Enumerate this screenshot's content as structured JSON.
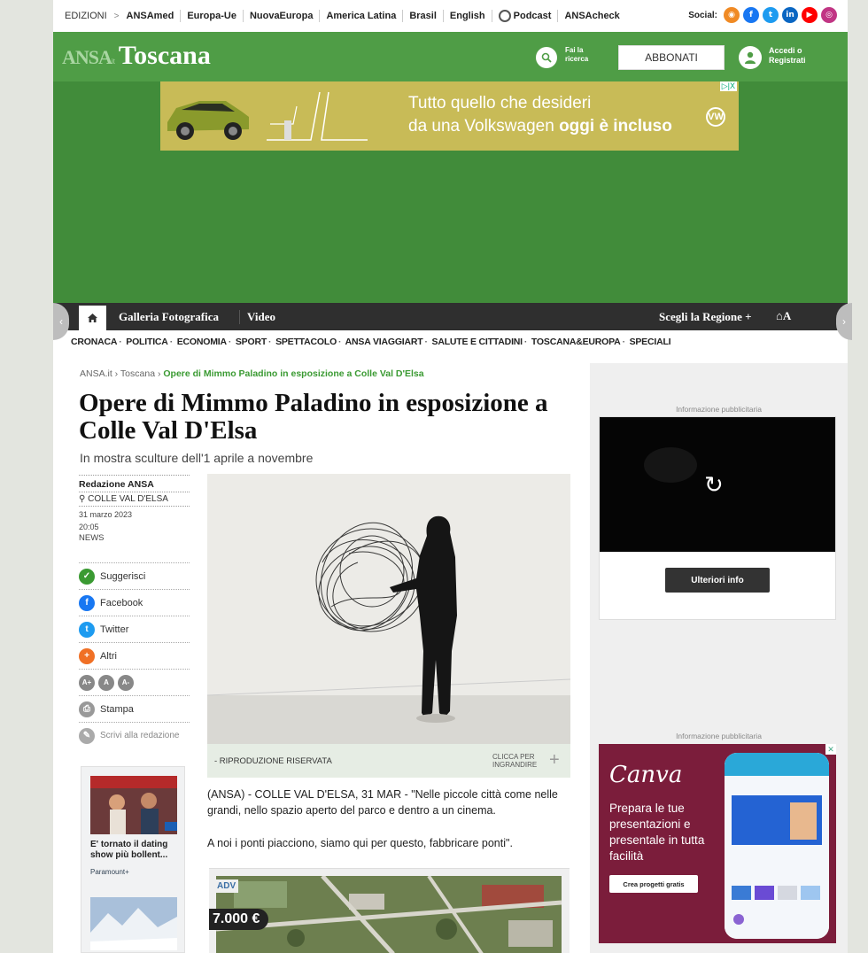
{
  "topbar": {
    "edition_label": "EDIZIONI",
    "links": [
      "ANSAmed",
      "Europa-Ue",
      "NuovaEuropa",
      "America Latina",
      "Brasil",
      "English",
      "Podcast",
      "ANSAcheck"
    ],
    "social_label": "Social:"
  },
  "header": {
    "logo_ansa": "ANSA",
    "logo_it": "it",
    "region": "Toscana",
    "search_label_1": "Fai la",
    "search_label_2": "ricerca",
    "subscribe": "ABBONATI",
    "login_1": "Accedi o",
    "login_2": "Registrati"
  },
  "banner": {
    "line1": "Tutto quello che desideri",
    "line2_plain": "da una Volkswagen ",
    "line2_bold": "oggi è incluso",
    "vw": "VW",
    "adchoice": "▷|X"
  },
  "nav": {
    "gallery": "Galleria Fotografica",
    "video": "Video",
    "region_pick": "Scegli la Regione +",
    "text_size": "A"
  },
  "subnav": [
    "CRONACA",
    "POLITICA",
    "ECONOMIA",
    "SPORT",
    "SPETTACOLO",
    "ANSA VIAGGIART",
    "SALUTE E CITTADINI",
    "TOSCANA&EUROPA",
    "SPECIALI"
  ],
  "breadcrumb": {
    "home": "ANSA.it",
    "section": "Toscana",
    "current": "Opere di Mimmo Paladino in esposizione a Colle Val D'Elsa"
  },
  "article": {
    "title": "Opere di Mimmo Paladino in esposizione a Colle Val D'Elsa",
    "subtitle": "In mostra sculture dell'1 aprile a novembre",
    "author": "Redazione ANSA",
    "location": "COLLE VAL D'ELSA",
    "date": "31 marzo 2023",
    "time": "20:05",
    "category": "NEWS",
    "photo_credit": "- RIPRODUZIONE RISERVATA",
    "enlarge_1": "CLICCA PER",
    "enlarge_2": "INGRANDIRE",
    "paragraph1": "(ANSA) - COLLE VAL D'ELSA, 31 MAR - \"Nelle piccole città come nelle grandi, nello spazio aperto del parco e dentro a un cinema.",
    "paragraph2": "A noi i ponti piacciono, siamo qui per questo, fabbricare ponti\"."
  },
  "share": {
    "suggest": "Suggerisci",
    "facebook": "Facebook",
    "twitter": "Twitter",
    "others": "Altri",
    "print": "Stampa",
    "write": "Scrivi alla redazione",
    "font_plus": "A+",
    "font_normal": "A",
    "font_minus": "A-"
  },
  "promo": {
    "caption": "E' tornato il dating show più bollent...",
    "source": "Paramount+"
  },
  "adv": {
    "tag": "ADV",
    "price": "7.000 €"
  },
  "sidebar": {
    "ad_label_1": "Informazione pubblicitaria",
    "more_info": "Ulteriori info",
    "ad_label_2": "Informazione pubblicitaria",
    "canva_brand": "Canva",
    "canva_pitch": "Prepara le tue presentazioni e presentale in tutta facilità",
    "canva_cta": "Crea progetti gratis"
  },
  "colors": {
    "green_header": "#418c3a",
    "green_bar": "#4f9d46",
    "nav_dark": "#2f2f2f",
    "accent_green": "#3a9a32",
    "canva": "#7b1d3b"
  }
}
